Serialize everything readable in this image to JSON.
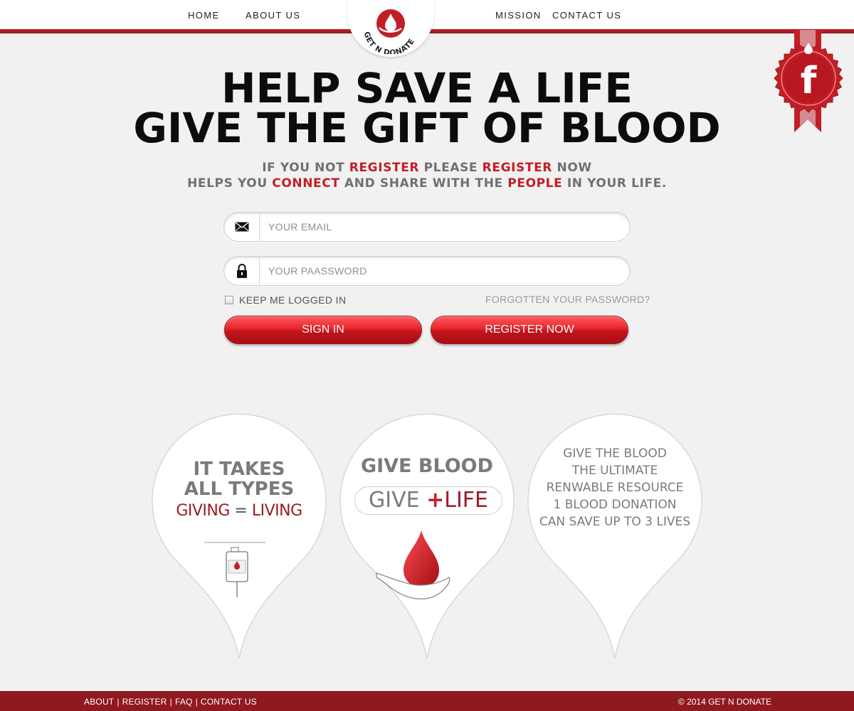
{
  "nav": {
    "home": "HOME",
    "about": "ABOUT US",
    "mission": "MISSION",
    "contact": "CONTACT US"
  },
  "logo": {
    "text": "GET N DONATE",
    "icon": "blood-drop-in-hand-icon"
  },
  "social": {
    "icon": "facebook-icon",
    "glyph": "f"
  },
  "headline": {
    "line1": "HELP SAVE A LIFE",
    "line2": "GIVE THE GIFT OF BLOOD"
  },
  "subline": {
    "l1_a": "IF YOU  NOT ",
    "l1_b": "REGISTER",
    "l1_c": " PLEASE ",
    "l1_d": "REGISTER",
    "l1_e": " NOW",
    "l2_a": "HELPS YOU ",
    "l2_b": "CONNECT",
    "l2_c": " AND SHARE WITH THE ",
    "l2_d": "PEOPLE",
    "l2_e": " IN YOUR LIFE."
  },
  "form": {
    "email_placeholder": "YOUR EMAIL",
    "password_placeholder": "YOUR PAASSWORD",
    "keep_logged": "KEEP ME LOGGED IN",
    "forgot": "FORGOTTEN YOUR PASSWORD?",
    "signin": "SIGN IN",
    "register": "REGISTER NOW"
  },
  "pins": {
    "p1": {
      "line1": "IT TAKES",
      "line2": "ALL TYPES",
      "giving": "GIVING",
      "eq": " = ",
      "living": "LIVING",
      "icon": "blood-bag-icon"
    },
    "p2": {
      "title": "GIVE BLOOD",
      "give": "GIVE ",
      "plus": "+",
      "life": "LIFE",
      "icon": "blood-drop-hand-icon"
    },
    "p3": {
      "lines": [
        "GIVE THE BLOOD",
        "THE ULTIMATE",
        "RENWABLE RESOURCE",
        "1 BLOOD DONATION",
        "CAN SAVE UP TO 3 LIVES"
      ]
    }
  },
  "footer": {
    "about": "ABOUT",
    "register": "REGISTER",
    "faq": "FAQ",
    "contact": "CONTACT US",
    "sep": "|",
    "copyright": "© 2014 GET N DONATE"
  },
  "colors": {
    "brand_red": "#c21e26",
    "dark_red": "#8e1a1f",
    "background": "#f1f1f1"
  }
}
